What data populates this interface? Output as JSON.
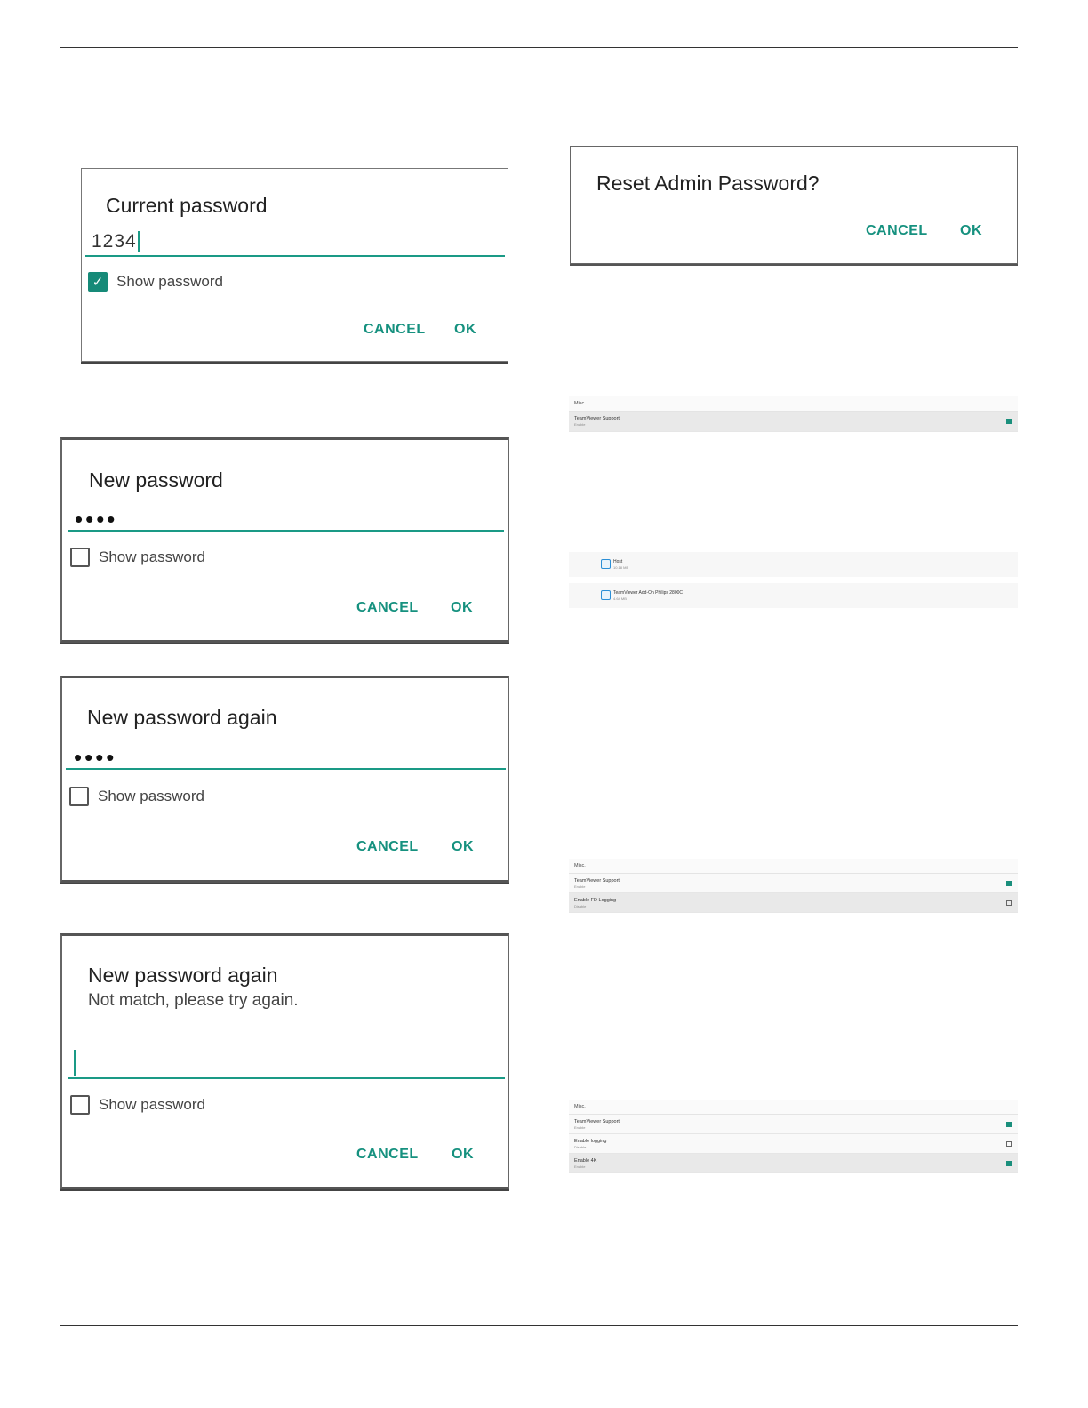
{
  "dialogs": {
    "current": {
      "title": "Current password",
      "value": "1234",
      "show_label": "Show password",
      "cancel": "CANCEL",
      "ok": "OK"
    },
    "new": {
      "title": "New password",
      "dots": "••••",
      "show_label": "Show password",
      "cancel": "CANCEL",
      "ok": "OK"
    },
    "again": {
      "title": "New password again",
      "dots": "••••",
      "show_label": "Show password",
      "cancel": "CANCEL",
      "ok": "OK"
    },
    "mismatch": {
      "title": "New password again",
      "message": "Not match, please try again.",
      "show_label": "Show password",
      "cancel": "CANCEL",
      "ok": "OK"
    },
    "reset": {
      "title": "Reset Admin Password?",
      "cancel": "CANCEL",
      "ok": "OK"
    }
  },
  "misc1": {
    "header": "Misc.",
    "rows": [
      {
        "title": "TeamViewer Support",
        "sub": "Enable",
        "checked": true
      }
    ]
  },
  "apps": [
    {
      "name": "Host",
      "size": "10.18 MB",
      "icon": "teamviewer-icon"
    },
    {
      "name": "TeamViewer Add-On Philips 2800C",
      "size": "4.64 MB",
      "icon": "teamviewer-icon"
    }
  ],
  "misc2": {
    "header": "Misc.",
    "rows": [
      {
        "title": "TeamViewer Support",
        "sub": "Enable",
        "checked": true
      },
      {
        "title": "Enable FD Logging",
        "sub": "Disable",
        "checked": false
      }
    ]
  },
  "misc3": {
    "header": "Misc.",
    "rows": [
      {
        "title": "TeamViewer Support",
        "sub": "Enable",
        "checked": true
      },
      {
        "title": "Enable logging",
        "sub": "Disable",
        "checked": false
      },
      {
        "title": "Enable 4K",
        "sub": "Enable",
        "checked": true
      }
    ]
  },
  "colors": {
    "accent": "#16917f",
    "checkbox": "#168a78"
  }
}
